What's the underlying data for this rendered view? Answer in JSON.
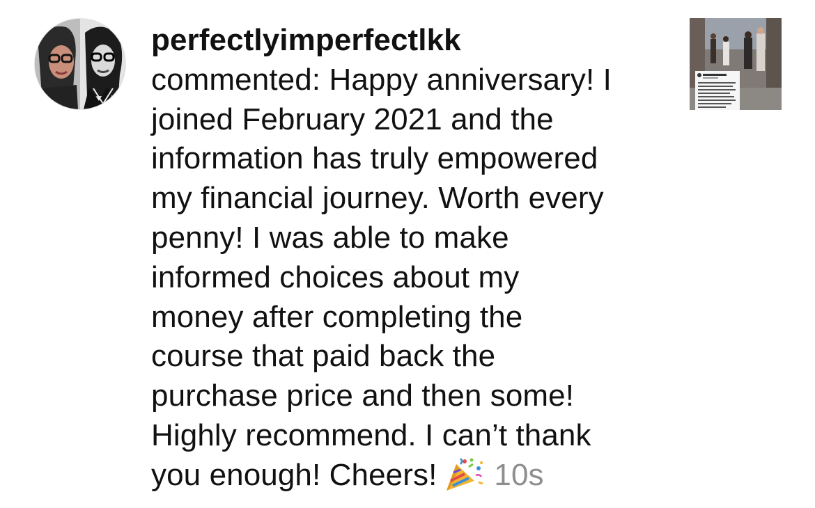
{
  "notification": {
    "username": "perfectlyimperfectlkk",
    "action": "commented:",
    "comment_lines": [
      "Happy anniversary! I",
      "joined February 2021 and the",
      "information has truly empowered",
      "my financial journey. Worth every",
      "penny! I was able to make",
      "informed choices about my",
      "money after completing the",
      "course that paid back the",
      "purchase price and then some!",
      "Highly recommend. I can’t thank",
      "you enough! Cheers!"
    ],
    "emoji_icon": "party-popper-icon",
    "timestamp": "10s",
    "avatar_icon": "profile-photo",
    "thumbnail_icon": "post-thumbnail"
  }
}
